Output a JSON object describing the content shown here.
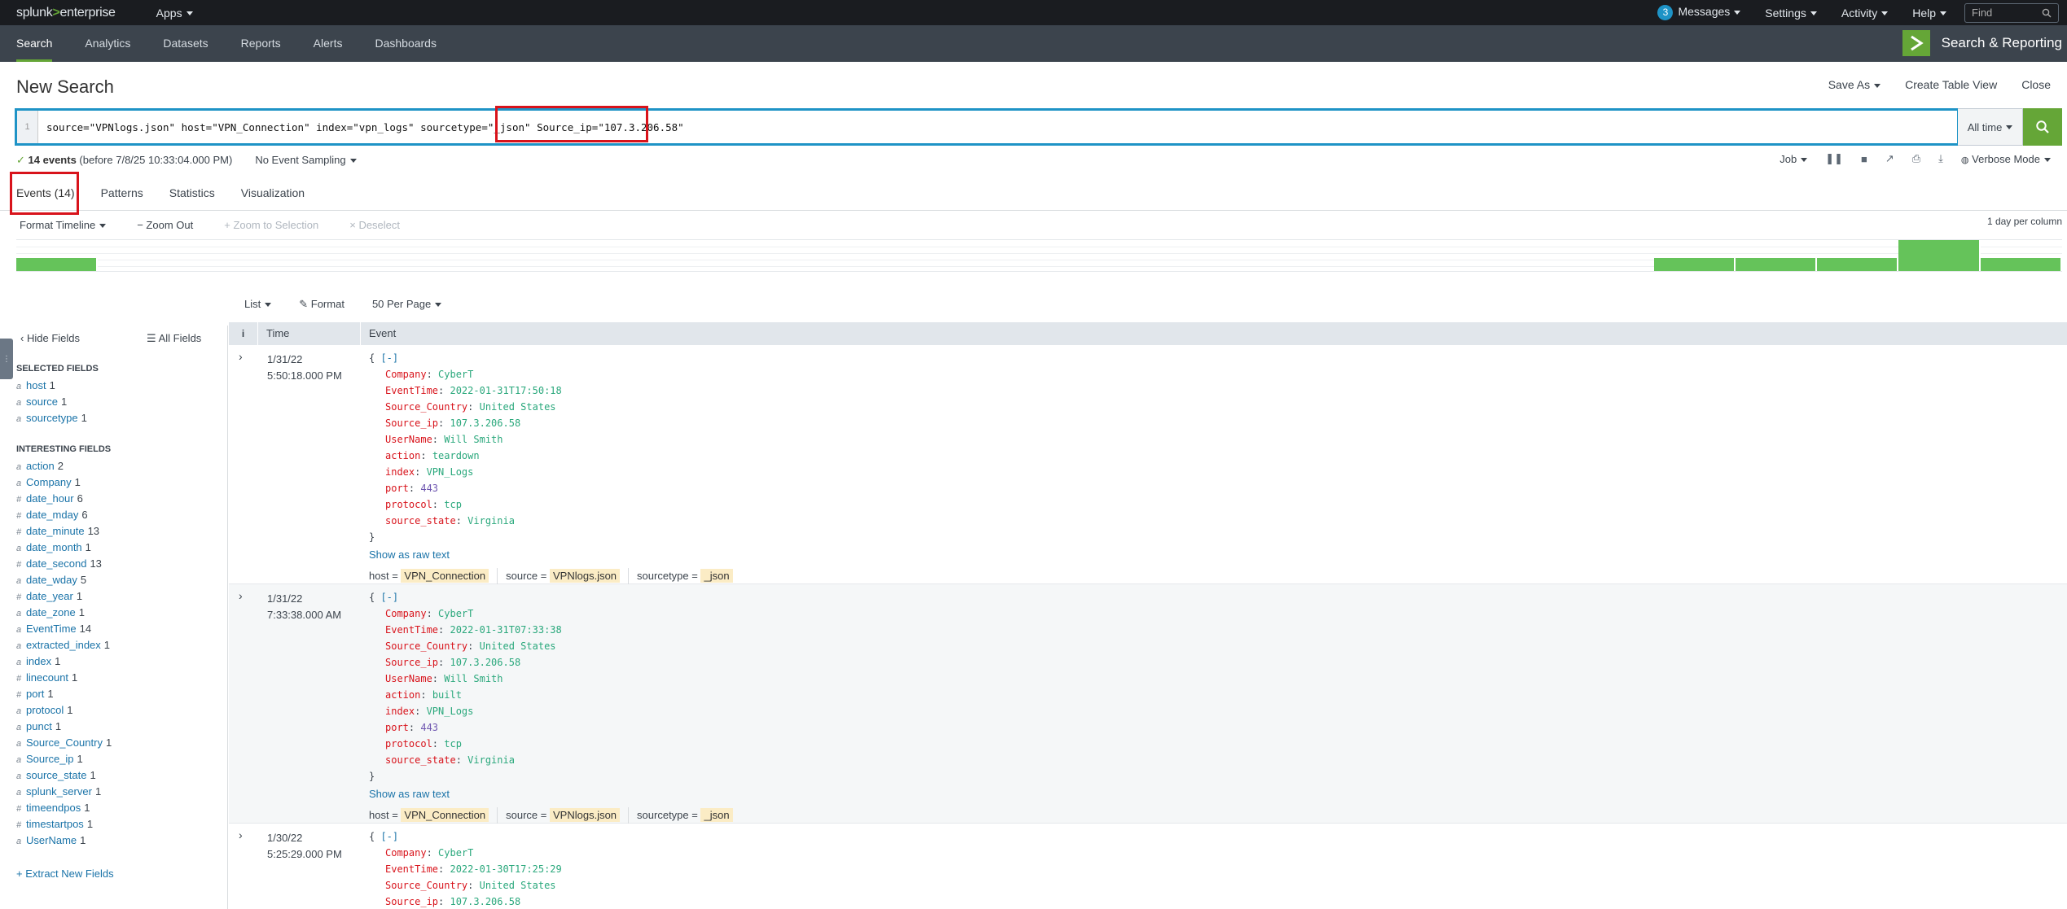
{
  "topbar": {
    "logo_prefix": "splunk",
    "logo_sep": ">",
    "logo_suffix": "enterprise",
    "apps": "Apps",
    "messages_count": "3",
    "messages": "Messages",
    "settings": "Settings",
    "activity": "Activity",
    "help": "Help",
    "find_placeholder": "Find"
  },
  "appbar": {
    "nav": [
      "Search",
      "Analytics",
      "Datasets",
      "Reports",
      "Alerts",
      "Dashboards"
    ],
    "app_title": "Search & Reporting"
  },
  "header": {
    "title": "New Search",
    "save_as": "Save As",
    "create_table_view": "Create Table View",
    "close": "Close"
  },
  "search": {
    "line_number": "1",
    "query_main": "source=\"VPNlogs.json\" host=\"VPN_Connection\" index=\"vpn_logs\" sourcetype=\"_json\"",
    "query_highlight": "Source_ip=\"107.3.206.58\"",
    "time_range": "All time"
  },
  "status": {
    "check": "✓",
    "events_count": "14 events",
    "before": "(before 7/8/25 10:33:04.000 PM)",
    "sampling": "No Event Sampling",
    "job": "Job",
    "mode": "Verbose Mode"
  },
  "tabs": [
    "Events (14)",
    "Patterns",
    "Statistics",
    "Visualization"
  ],
  "timeline": {
    "format": "Format Timeline",
    "zoom_out": "Zoom Out",
    "zoom_selection": "Zoom to Selection",
    "deselect": "Deselect",
    "per_column": "1 day per column",
    "bars": [
      0.42,
      0.42,
      0.42,
      0.42,
      1.0,
      0.42
    ]
  },
  "list_controls": {
    "list": "List",
    "format": "Format",
    "per_page": "50 Per Page"
  },
  "sidebar": {
    "hide_fields": "Hide Fields",
    "all_fields": "All Fields",
    "selected_label": "SELECTED FIELDS",
    "selected": [
      {
        "type": "a",
        "name": "host",
        "count": "1"
      },
      {
        "type": "a",
        "name": "source",
        "count": "1"
      },
      {
        "type": "a",
        "name": "sourcetype",
        "count": "1"
      }
    ],
    "interesting_label": "INTERESTING FIELDS",
    "interesting": [
      {
        "type": "a",
        "name": "action",
        "count": "2"
      },
      {
        "type": "a",
        "name": "Company",
        "count": "1"
      },
      {
        "type": "#",
        "name": "date_hour",
        "count": "6"
      },
      {
        "type": "#",
        "name": "date_mday",
        "count": "6"
      },
      {
        "type": "#",
        "name": "date_minute",
        "count": "13"
      },
      {
        "type": "a",
        "name": "date_month",
        "count": "1"
      },
      {
        "type": "#",
        "name": "date_second",
        "count": "13"
      },
      {
        "type": "a",
        "name": "date_wday",
        "count": "5"
      },
      {
        "type": "#",
        "name": "date_year",
        "count": "1"
      },
      {
        "type": "a",
        "name": "date_zone",
        "count": "1"
      },
      {
        "type": "a",
        "name": "EventTime",
        "count": "14"
      },
      {
        "type": "a",
        "name": "extracted_index",
        "count": "1"
      },
      {
        "type": "a",
        "name": "index",
        "count": "1"
      },
      {
        "type": "#",
        "name": "linecount",
        "count": "1"
      },
      {
        "type": "#",
        "name": "port",
        "count": "1"
      },
      {
        "type": "a",
        "name": "protocol",
        "count": "1"
      },
      {
        "type": "a",
        "name": "punct",
        "count": "1"
      },
      {
        "type": "a",
        "name": "Source_Country",
        "count": "1"
      },
      {
        "type": "a",
        "name": "Source_ip",
        "count": "1"
      },
      {
        "type": "a",
        "name": "source_state",
        "count": "1"
      },
      {
        "type": "a",
        "name": "splunk_server",
        "count": "1"
      },
      {
        "type": "#",
        "name": "timeendpos",
        "count": "1"
      },
      {
        "type": "#",
        "name": "timestartpos",
        "count": "1"
      },
      {
        "type": "a",
        "name": "UserName",
        "count": "1"
      }
    ],
    "extract": "+ Extract New Fields"
  },
  "table": {
    "col_i": "i",
    "col_time": "Time",
    "col_event": "Event",
    "show_raw": "Show as raw text",
    "events": [
      {
        "date": "1/31/22",
        "time": "5:50:18.000 PM",
        "fields": [
          {
            "k": "Company",
            "v": "CyberT"
          },
          {
            "k": "EventTime",
            "v": "2022-01-31T17:50:18"
          },
          {
            "k": "Source_Country",
            "v": "United States"
          },
          {
            "k": "Source_ip",
            "v": "107.3.206.58"
          },
          {
            "k": "UserName",
            "v": "Will Smith"
          },
          {
            "k": "action",
            "v": "teardown"
          },
          {
            "k": "index",
            "v": "VPN_Logs"
          },
          {
            "k": "port",
            "v": "443",
            "num": true
          },
          {
            "k": "protocol",
            "v": "tcp"
          },
          {
            "k": "source_state",
            "v": "Virginia"
          }
        ],
        "host": "VPN_Connection",
        "source": "VPNlogs.json",
        "sourcetype": "_json"
      },
      {
        "date": "1/31/22",
        "time": "7:33:38.000 AM",
        "fields": [
          {
            "k": "Company",
            "v": "CyberT"
          },
          {
            "k": "EventTime",
            "v": "2022-01-31T07:33:38"
          },
          {
            "k": "Source_Country",
            "v": "United States"
          },
          {
            "k": "Source_ip",
            "v": "107.3.206.58"
          },
          {
            "k": "UserName",
            "v": "Will Smith"
          },
          {
            "k": "action",
            "v": "built"
          },
          {
            "k": "index",
            "v": "VPN_Logs"
          },
          {
            "k": "port",
            "v": "443",
            "num": true
          },
          {
            "k": "protocol",
            "v": "tcp"
          },
          {
            "k": "source_state",
            "v": "Virginia"
          }
        ],
        "host": "VPN_Connection",
        "source": "VPNlogs.json",
        "sourcetype": "_json"
      },
      {
        "date": "1/30/22",
        "time": "5:25:29.000 PM",
        "fields": [
          {
            "k": "Company",
            "v": "CyberT"
          },
          {
            "k": "EventTime",
            "v": "2022-01-30T17:25:29"
          },
          {
            "k": "Source_Country",
            "v": "United States"
          },
          {
            "k": "Source_ip",
            "v": "107.3.206.58"
          }
        ],
        "host": "",
        "source": "",
        "sourcetype": ""
      }
    ]
  },
  "colors": {
    "accent_green": "#65a637",
    "highlight_red": "#d8131b",
    "search_blue": "#1e93c6"
  }
}
